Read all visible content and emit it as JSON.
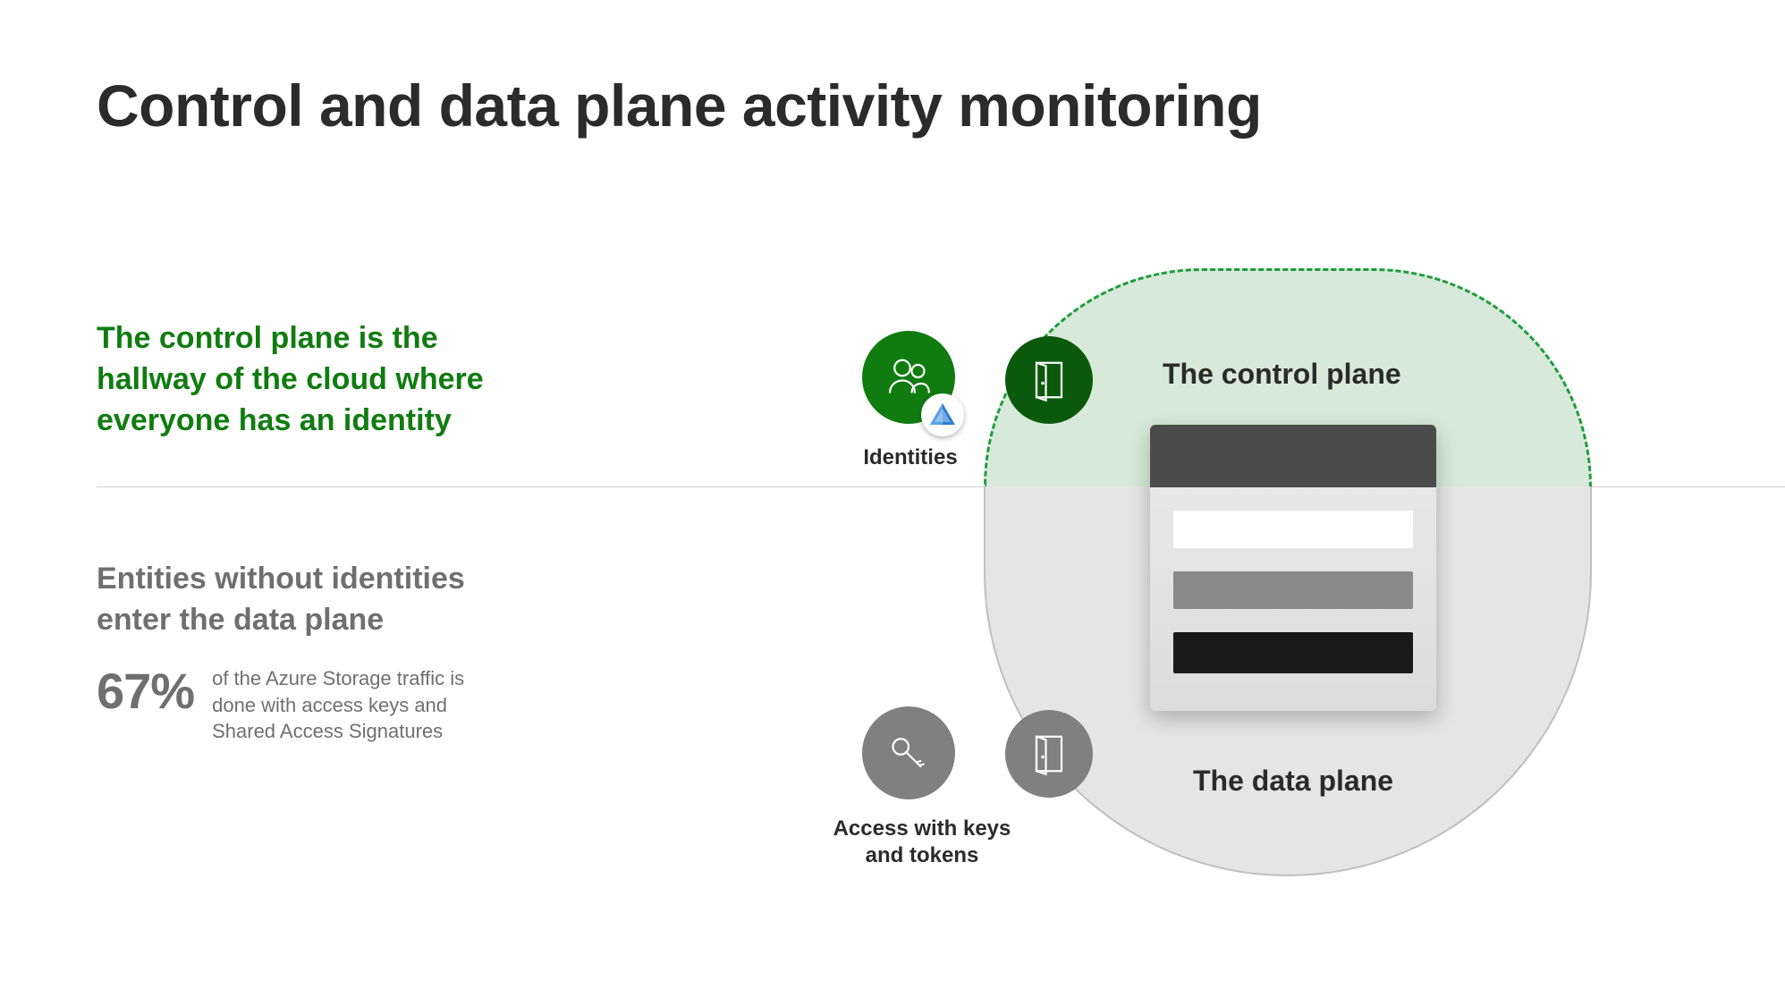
{
  "slide": {
    "title": "Control and data plane activity monitoring",
    "left": {
      "control_blurb": "The control plane is the hallway of the cloud where everyone has an identity",
      "data_blurb": "Entities without identities enter the data plane",
      "stat_value": "67%",
      "stat_desc": "of the Azure Storage traffic is done with access keys and Shared Access Signatures"
    },
    "diagram": {
      "control_label": "The control plane",
      "data_label": "The data plane",
      "identities_caption": "Identities",
      "keys_caption": "Access with keys and tokens"
    },
    "colors": {
      "green": "#107c10",
      "gray": "#6f6f6f"
    }
  }
}
